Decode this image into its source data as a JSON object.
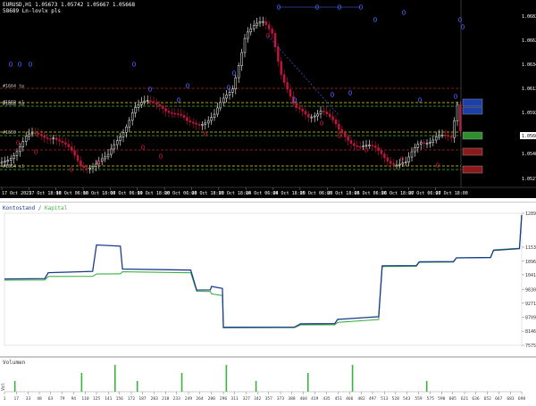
{
  "price_chart": {
    "title": "EURUSD,H1 1.05673 1.05742 1.05667 1.05668",
    "subtitle1": "58689",
    "subtitle2": "Ln-lovlx pls",
    "y_ticks": [
      "1.06830",
      "1.06620",
      "1.06340",
      "1.06130",
      "1.05920",
      "1.05695",
      "1.05480",
      "1.05270"
    ],
    "current_price": "1.05668",
    "x_ticks": [
      "17 Oct 2023",
      "17 Oct 18:00",
      "18 Oct 06:00",
      "18 Oct 18:00",
      "19 Oct 06:00",
      "19 Oct 18:00",
      "20 Oct 06:00",
      "20 Oct 18:00",
      "23 Oct 18:00",
      "24 Oct 06:00",
      "24 Oct 18:00",
      "25 Oct 06:00",
      "25 Oct 18:00",
      "26 Oct 06:00",
      "26 Oct 18:00",
      "27 Oct 06:00",
      "27 Oct 18:00"
    ],
    "labels": [
      "#1664 tp",
      "#1668 tp",
      "#1669 sl",
      "#1669",
      "#1664 sl"
    ],
    "colors": {
      "bull": "#ffffff",
      "bear": "#c0143c",
      "entry": "#4a66ff",
      "level_red": "#8b1a1a",
      "level_green": "#2f8f2f",
      "level_yellow": "#b59f00"
    }
  },
  "equity_chart": {
    "label_a": "Kontostand",
    "separator": " / ",
    "label_b": "Kapital",
    "y_ticks": [
      "12897",
      "11532",
      "10964",
      "10418",
      "9830",
      "9271",
      "8709",
      "8146",
      "7575"
    ],
    "colors": {
      "balance": "#1a3a8c",
      "equity": "#3cb043"
    }
  },
  "volume_chart": {
    "label": "Volumen",
    "side_label": "Vol"
  },
  "trade_axis": {
    "ticks": [
      "1",
      "17",
      "33",
      "48",
      "63",
      "79",
      "94",
      "110",
      "125",
      "141",
      "156",
      "172",
      "187",
      "203",
      "218",
      "233",
      "249",
      "264",
      "280",
      "296",
      "311",
      "327",
      "342",
      "357",
      "373",
      "388",
      "404",
      "419",
      "435",
      "451",
      "466",
      "482",
      "497",
      "513",
      "528",
      "543",
      "559",
      "575",
      "590",
      "605",
      "621",
      "636",
      "652",
      "667",
      "683",
      "698"
    ]
  },
  "chart_data": [
    {
      "type": "line",
      "title": "",
      "series": [
        {
          "name": "Kontostand",
          "values": [
            10250,
            10500,
            11620,
            10650,
            9800,
            9950,
            8300,
            8440,
            8620,
            10780,
            10940,
            11100,
            11400,
            12830
          ]
        },
        {
          "name": "Kapital",
          "values": [
            10200,
            10350,
            10450,
            10540,
            9750,
            9650,
            8280,
            8400,
            8500,
            10750,
            10920,
            11100,
            11420,
            12830
          ]
        }
      ],
      "x": [
        1,
        60,
        125,
        160,
        260,
        280,
        296,
        400,
        450,
        510,
        560,
        610,
        660,
        698
      ]
    },
    {
      "type": "bar",
      "title": "",
      "series": [
        {
          "name": "Volumen",
          "values": [
            1,
            1,
            1,
            1,
            1,
            1,
            1,
            1,
            1,
            1
          ]
        }
      ],
      "x": [
        15,
        105,
        150,
        180,
        240,
        300,
        340,
        410,
        470,
        570
      ]
    }
  ]
}
